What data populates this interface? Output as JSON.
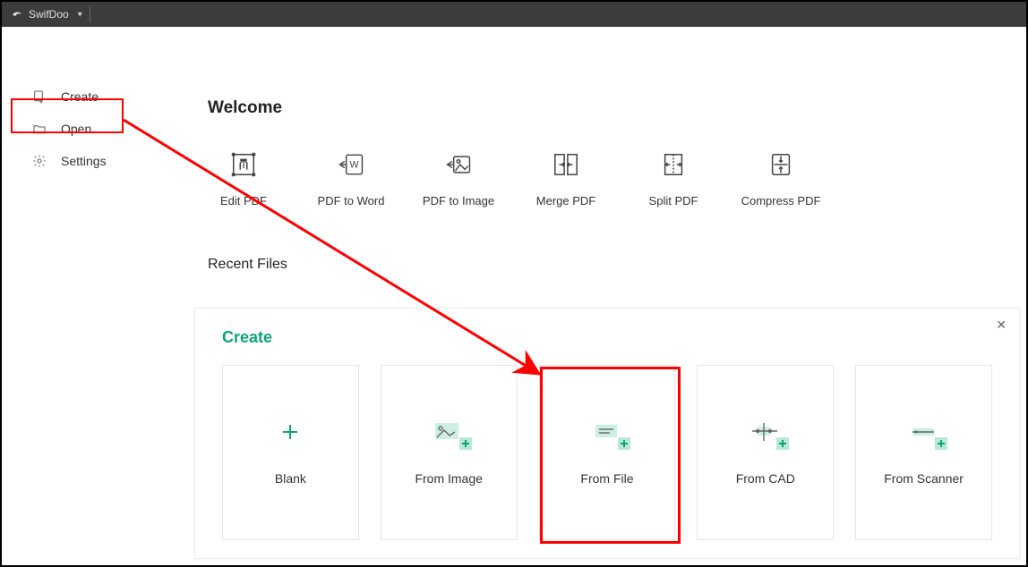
{
  "app": {
    "name": "SwifDoo"
  },
  "sidebar": {
    "items": [
      {
        "label": "Create"
      },
      {
        "label": "Open"
      },
      {
        "label": "Settings"
      }
    ]
  },
  "main": {
    "welcome": "Welcome",
    "actions": [
      {
        "label": "Edit PDF"
      },
      {
        "label": "PDF to Word"
      },
      {
        "label": "PDF to Image"
      },
      {
        "label": "Merge PDF"
      },
      {
        "label": "Split PDF"
      },
      {
        "label": "Compress PDF"
      }
    ],
    "recent": "Recent Files"
  },
  "panel": {
    "title": "Create",
    "cards": [
      {
        "label": "Blank"
      },
      {
        "label": "From Image"
      },
      {
        "label": "From File"
      },
      {
        "label": "From CAD"
      },
      {
        "label": "From Scanner"
      }
    ]
  }
}
